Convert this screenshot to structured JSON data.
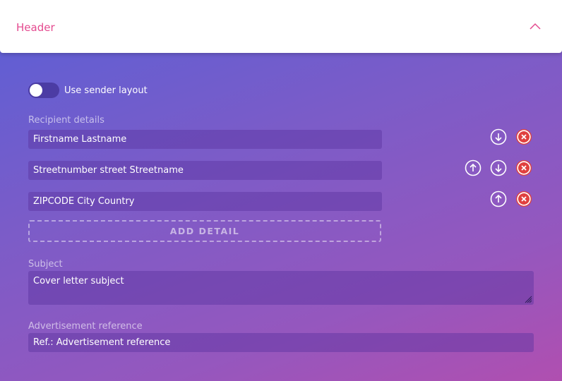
{
  "header": {
    "title": "Header",
    "collapse_icon": "chevron-up-icon"
  },
  "layout_toggle": {
    "label": "Use sender layout",
    "enabled": false
  },
  "recipient": {
    "label": "Recipient details",
    "lines": [
      {
        "value": "Firstname Lastname"
      },
      {
        "value": "Streetnumber street Streetname"
      },
      {
        "value": "ZIPCODE City Country"
      }
    ],
    "add_label": "ADD DETAIL"
  },
  "subject": {
    "label": "Subject",
    "value": "Cover letter subject"
  },
  "advertisement": {
    "label": "Advertisement reference",
    "value": "Ref.: Advertisement reference"
  },
  "colors": {
    "accent": "#e44a8f",
    "delete": "#e0413f",
    "gradient_start": "#5a5fd6",
    "gradient_end": "#b04fb0"
  }
}
